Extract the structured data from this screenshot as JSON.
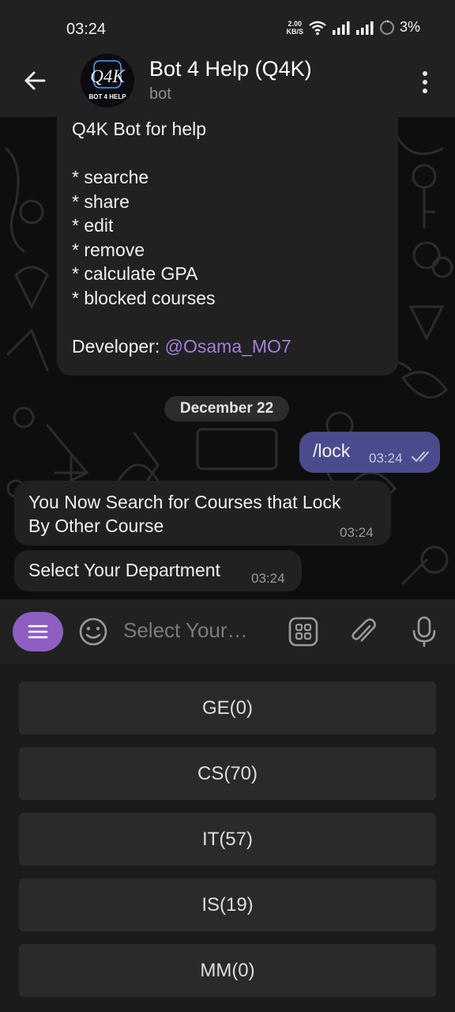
{
  "status_bar": {
    "time": "03:24",
    "speed_value": "2.00",
    "speed_unit": "KB/S",
    "battery": "3%"
  },
  "header": {
    "title": "Bot 4 Help (Q4K)",
    "subtitle": "bot",
    "avatar_logo": "Q4K",
    "avatar_caption": "BOT 4 HELP"
  },
  "messages": {
    "intro": {
      "title": "Q4K Bot for help",
      "features": [
        "* searche",
        "* share",
        "* edit",
        "* remove",
        "* calculate GPA",
        "* blocked courses"
      ],
      "developer_label": "Developer: ",
      "developer_handle": "@Osama_MO7"
    },
    "date_separator": "December 22",
    "outgoing": {
      "text": "/lock",
      "time": "03:24"
    },
    "incoming1": {
      "line1": "You Now Search for Courses that Lock",
      "line2": "By Other Course",
      "time": "03:24"
    },
    "incoming2": {
      "text": "Select Your Department",
      "time": "03:24"
    }
  },
  "input": {
    "placeholder": "Select Your…"
  },
  "keyboard": {
    "buttons": [
      "GE(0)",
      "CS(70)",
      "IT(57)",
      "IS(19)",
      "MM(0)"
    ]
  },
  "colors": {
    "accent": "#8e5ec2",
    "outgoing_bubble": "#4a4b8c",
    "link": "#a07fdc",
    "background": "#0e0e0e"
  }
}
